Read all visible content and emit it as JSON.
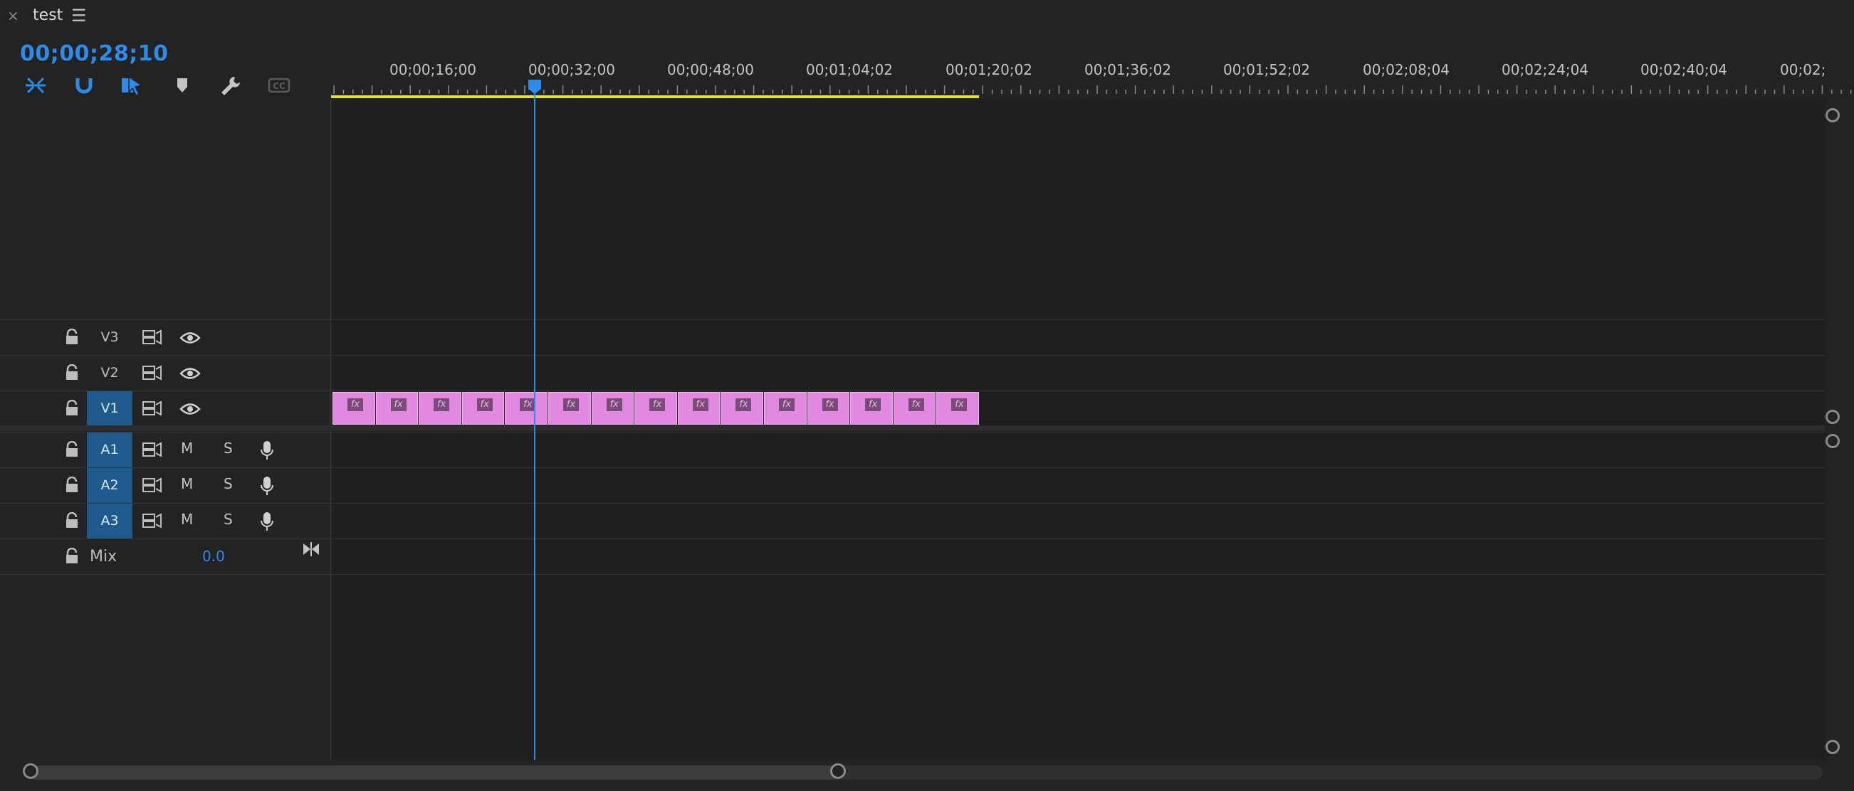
{
  "tab": {
    "title": "test",
    "close_glyph": "×",
    "menu_glyph": "☰"
  },
  "timecode": "00;00;28;10",
  "tools": [
    {
      "name": "nest-sequence-icon",
      "active": true
    },
    {
      "name": "snap-icon",
      "active": true
    },
    {
      "name": "linked-selection-icon",
      "active": true
    },
    {
      "name": "add-marker-icon",
      "active": false
    },
    {
      "name": "wrench-icon",
      "active": false
    },
    {
      "name": "captions-icon",
      "active": false,
      "label": "CC"
    }
  ],
  "ruler": {
    "labels": [
      "00;00;16;00",
      "00;00;32;00",
      "00;00;48;00",
      "00;01;04;02",
      "00;01;20;02",
      "00;01;36;02",
      "00;01;52;02",
      "00;02;08;04",
      "00;02;24;04",
      "00;02;40;04",
      "00;02;"
    ]
  },
  "video_tracks": [
    {
      "name": "V3",
      "targeted": false
    },
    {
      "name": "V2",
      "targeted": false
    },
    {
      "name": "V1",
      "targeted": true
    }
  ],
  "audio_tracks": [
    {
      "name": "A1",
      "targeted": true,
      "mute": "M",
      "solo": "S"
    },
    {
      "name": "A2",
      "targeted": true,
      "mute": "M",
      "solo": "S"
    },
    {
      "name": "A3",
      "targeted": true,
      "mute": "M",
      "solo": "S"
    }
  ],
  "mix": {
    "label": "Mix",
    "value": "0.0"
  },
  "clips": {
    "count": 15,
    "badge": "fx",
    "color": "#e189e1"
  },
  "colors": {
    "accent": "#2d8ceb",
    "workarea": "#e4e420",
    "target": "#1e5a8c"
  }
}
